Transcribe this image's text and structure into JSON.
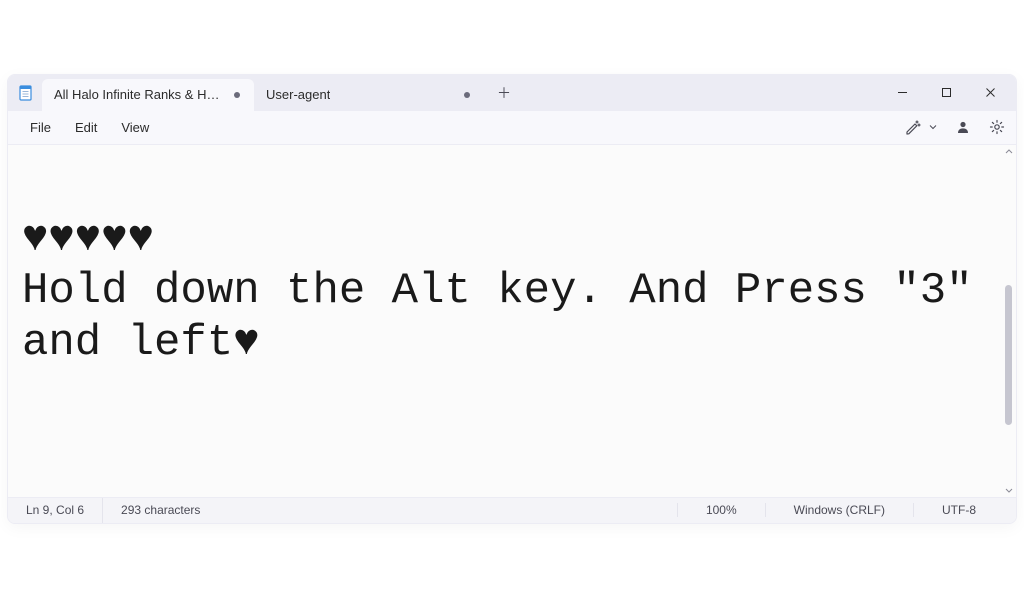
{
  "app": {
    "name": "Notepad"
  },
  "tabs": [
    {
      "label": "All Halo Infinite Ranks & How the F",
      "dirty": true,
      "active": true
    },
    {
      "label": "User-agent",
      "dirty": true,
      "active": false
    }
  ],
  "menu": {
    "file": "File",
    "edit": "Edit",
    "view": "View"
  },
  "editor": {
    "content": "\n♥♥♥♥♥\nHold down the Alt key. And Press \"3\" and left♥"
  },
  "status": {
    "position": "Ln 9, Col 6",
    "characters": "293 characters",
    "zoom": "100%",
    "line_ending": "Windows (CRLF)",
    "encoding": "UTF-8"
  },
  "window_controls": {
    "minimize": "Minimize",
    "maximize": "Maximize",
    "close": "Close"
  },
  "icons": {
    "new_tab": "＋"
  }
}
